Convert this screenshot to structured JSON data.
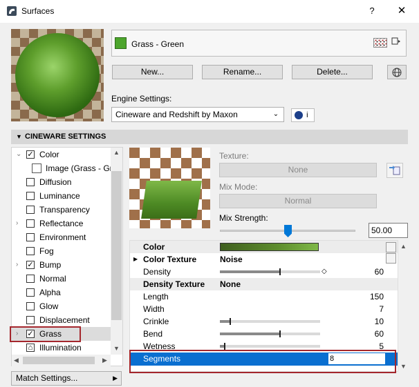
{
  "window": {
    "title": "Surfaces",
    "help": "?",
    "close": "✕"
  },
  "surface": {
    "name": "Grass - Green",
    "swatch_color": "#4ca52c"
  },
  "buttons": {
    "new": "New...",
    "rename": "Rename...",
    "delete": "Delete..."
  },
  "engine": {
    "label": "Engine Settings:",
    "value": "Cineware and Redshift by Maxon",
    "info": "i"
  },
  "section": {
    "title": "CINEWARE SETTINGS"
  },
  "channels": [
    {
      "label": "Color",
      "checked": true,
      "expanded": true
    },
    {
      "label": "Image (Grass - Gre",
      "sub": true
    },
    {
      "label": "Diffusion",
      "checked": false
    },
    {
      "label": "Luminance",
      "checked": false
    },
    {
      "label": "Transparency",
      "checked": false
    },
    {
      "label": "Reflectance",
      "checked": false,
      "expandable": true
    },
    {
      "label": "Environment",
      "checked": false
    },
    {
      "label": "Fog",
      "checked": false
    },
    {
      "label": "Bump",
      "checked": true,
      "expandable": true
    },
    {
      "label": "Normal",
      "checked": false
    },
    {
      "label": "Alpha",
      "checked": false
    },
    {
      "label": "Glow",
      "checked": false
    },
    {
      "label": "Displacement",
      "checked": false
    },
    {
      "label": "Grass",
      "checked": true,
      "expandable": true,
      "selected": true
    },
    {
      "label": "Illumination",
      "lock": true
    }
  ],
  "match_settings": "Match Settings...",
  "texture": {
    "texture_label": "Texture:",
    "texture_value": "None",
    "mix_mode_label": "Mix Mode:",
    "mix_mode_value": "Normal",
    "mix_strength_label": "Mix Strength:",
    "mix_strength_value": "50.00",
    "mix_strength_fraction": 0.5
  },
  "properties": {
    "color_label": "Color",
    "color_texture_label": "Color Texture",
    "color_texture_value": "Noise",
    "density_label": "Density",
    "density_value": "60",
    "density_fraction": 0.6,
    "density_texture_label": "Density Texture",
    "density_texture_value": "None",
    "length_label": "Length",
    "length_value": "150",
    "width_label": "Width",
    "width_value": "7",
    "crinkle_label": "Crinkle",
    "crinkle_value": "10",
    "crinkle_fraction": 0.1,
    "bend_label": "Bend",
    "bend_value": "60",
    "bend_fraction": 0.6,
    "wetness_label": "Wetness",
    "wetness_value": "5",
    "wetness_fraction": 0.05,
    "segments_label": "Segments",
    "segments_value": "8"
  }
}
